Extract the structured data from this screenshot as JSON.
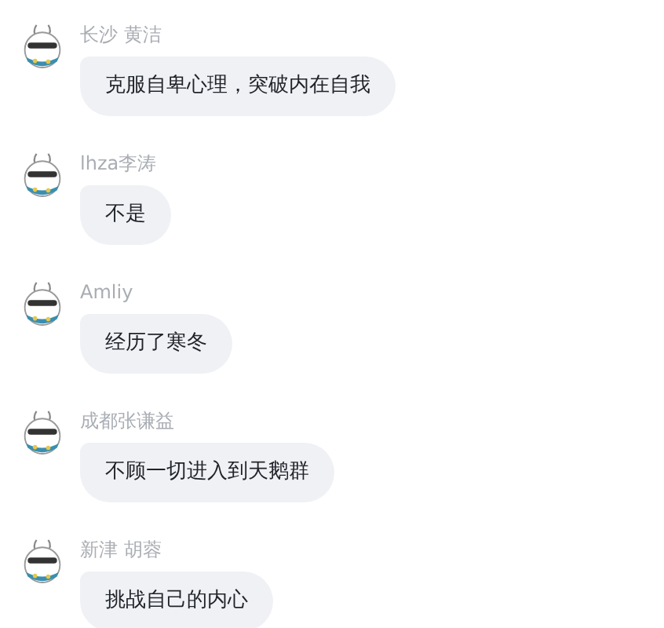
{
  "messages": [
    {
      "sender": "长沙 黄洁",
      "text": "克服自卑心理，突破内在自我"
    },
    {
      "sender": "lhza李涛",
      "text": "不是"
    },
    {
      "sender": "Amliy",
      "text": "经历了寒冬"
    },
    {
      "sender": "成都张谦益",
      "text": "不顾一切进入到天鹅群"
    },
    {
      "sender": "新津 胡蓉",
      "text": "挑战自己的内心"
    }
  ]
}
